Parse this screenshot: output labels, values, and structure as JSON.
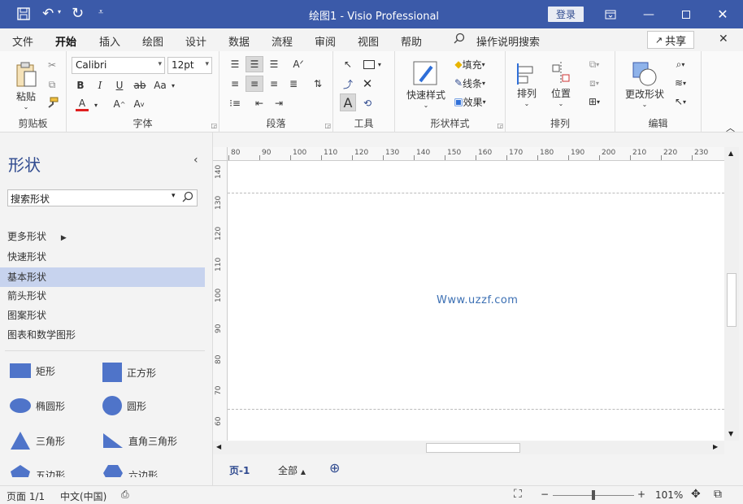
{
  "titlebar": {
    "title": "绘图1 - Visio Professional",
    "login": "登录",
    "qat": {
      "save": "save-icon",
      "undo": "undo-icon",
      "redo": "redo-icon",
      "customize": "dropdown-icon"
    }
  },
  "tabs": [
    "文件",
    "开始",
    "插入",
    "绘图",
    "设计",
    "数据",
    "流程",
    "审阅",
    "视图",
    "帮助"
  ],
  "active_tab": "开始",
  "tell_me": "操作说明搜索",
  "share": "共享",
  "ribbon": {
    "clipboard": {
      "label": "剪贴板",
      "paste": "粘贴"
    },
    "font": {
      "label": "字体",
      "font_name": "Calibri",
      "font_size": "12pt",
      "bold": "B",
      "italic": "I",
      "underline": "U",
      "strike": "ab",
      "case": "Aa",
      "color": "A",
      "grow": "A",
      "shrink": "A"
    },
    "paragraph": {
      "label": "段落"
    },
    "tools": {
      "label": "工具",
      "text_tool": "A"
    },
    "shape_styles": {
      "label": "形状样式",
      "quick_styles": "快速样式",
      "fill": "填充",
      "line": "线条",
      "effects": "效果"
    },
    "arrange": {
      "label": "排列",
      "arrange_btn": "排列",
      "position": "位置"
    },
    "edit": {
      "label": "编辑",
      "change_shape": "更改形状"
    }
  },
  "panel": {
    "title": "形状",
    "search_placeholder": "搜索形状",
    "nav": [
      "更多形状",
      "快速形状",
      "基本形状",
      "箭头形状",
      "图案形状",
      "图表和数学图形"
    ],
    "selected_nav": "基本形状",
    "shapes": [
      "矩形",
      "正方形",
      "椭圆形",
      "圆形",
      "三角形",
      "直角三角形",
      "五边形",
      "六边形"
    ]
  },
  "ruler": {
    "top": [
      "80",
      "90",
      "100",
      "110",
      "120",
      "130",
      "140",
      "150",
      "160",
      "170",
      "180",
      "190",
      "200",
      "210",
      "220",
      "230"
    ],
    "left": [
      "140",
      "130",
      "120",
      "110",
      "100",
      "90",
      "80",
      "70",
      "60"
    ]
  },
  "canvas": {
    "watermark": "Www.uzzf.com"
  },
  "page_tabs": {
    "page": "页-1",
    "all": "全部"
  },
  "status": {
    "page": "页面 1/1",
    "lang": "中文(中国)",
    "zoom": "101%"
  },
  "colors": {
    "accent": "#3b5aa9",
    "shape_fill": "#4f74c9",
    "selection": "#c7d3ee"
  }
}
